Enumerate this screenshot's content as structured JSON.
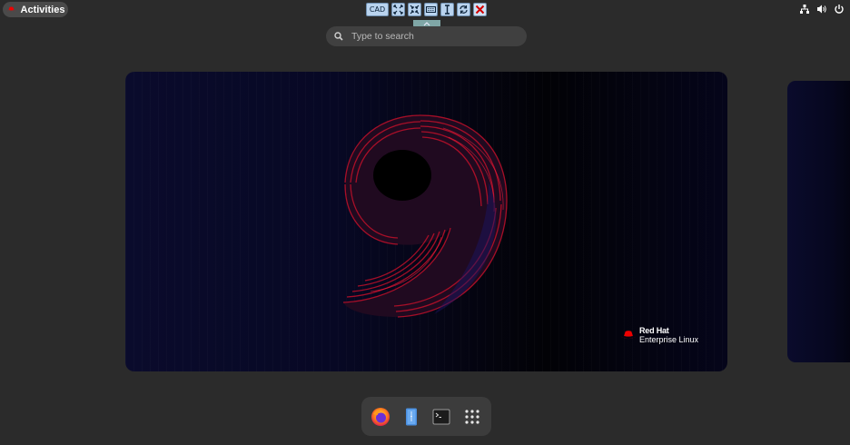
{
  "topbar": {
    "activities_label": "Activities",
    "tray_icons": [
      "network-icon",
      "volume-icon",
      "power-icon"
    ]
  },
  "vm_toolbar": {
    "cad_label": "CAD",
    "buttons": [
      "ctrl-alt-del",
      "fullscreen",
      "fit-window",
      "keyboard",
      "text-cursor",
      "refresh",
      "close"
    ]
  },
  "search": {
    "placeholder": "Type to search"
  },
  "wallpaper": {
    "digit": "9",
    "brand_line1": "Red Hat",
    "brand_line2": "Enterprise Linux"
  },
  "dock": {
    "apps": [
      "firefox",
      "files",
      "terminal",
      "show-applications"
    ]
  },
  "colors": {
    "background": "#2b2b2b",
    "brand_red": "#ee0000",
    "toolbar_blue": "#b9d3ee"
  }
}
